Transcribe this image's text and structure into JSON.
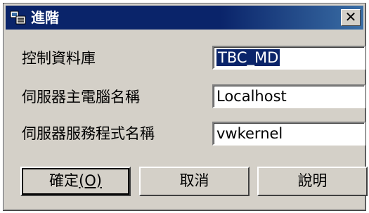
{
  "window": {
    "title": "進階",
    "close_glyph": "✕"
  },
  "form": {
    "control_db_label": "控制資料庫",
    "control_db_value": "TBC_MD",
    "server_host_label": "伺服器主電腦名稱",
    "server_host_value": "Localhost",
    "server_service_label": "伺服器服務程式名稱",
    "server_service_value": "vwkernel"
  },
  "buttons": {
    "ok_label": "確定",
    "ok_accel": "(O)",
    "cancel_label": "取消",
    "help_label": "說明"
  },
  "colors": {
    "titlebar": "#0a246a",
    "selection": "#0a246a",
    "face": "#d4d0c8"
  },
  "icons": {
    "title": "app-icon",
    "close": "close-icon"
  }
}
